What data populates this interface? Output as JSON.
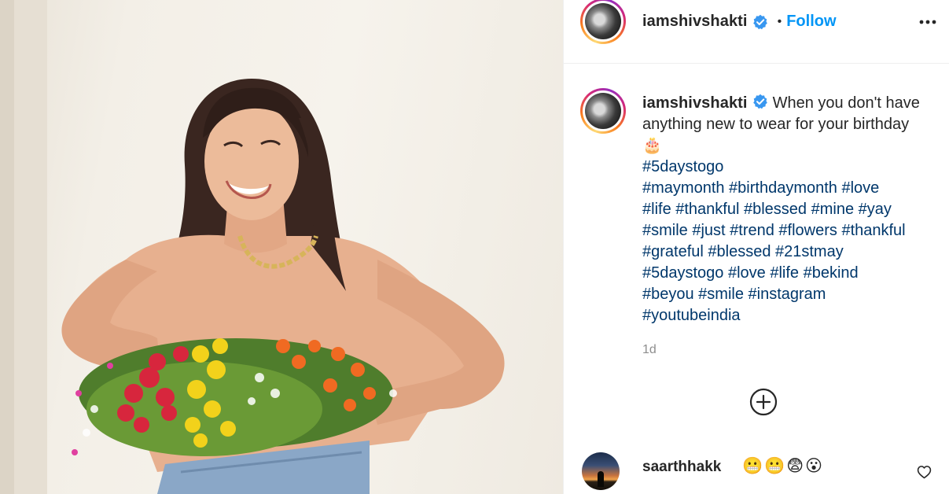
{
  "post": {
    "author": "iamshivshakti",
    "follow_label": "Follow",
    "separator": "•",
    "caption": {
      "text": "When you don't have anything new to wear for your birthday",
      "emoji": "🎂",
      "hashtag_lines": [
        "#5daystogo",
        "#maymonth #birthdaymonth #love",
        "#life #thankful #blessed #mine #yay",
        "#smile #just #trend #flowers #thankful",
        "#grateful #blessed #21stmay",
        "#5daystogo #love #life #bekind",
        "#beyou #smile #instagram",
        "#youtubeindia"
      ],
      "time": "1d"
    },
    "comment": {
      "user": "saarthhakk",
      "text": "😬😬😨😮"
    }
  },
  "icons": {
    "verified": "verified-badge-icon",
    "more": "more-options-icon",
    "add": "add-comment-icon",
    "like": "heart-icon"
  },
  "colors": {
    "link_blue": "#0095f6",
    "hashtag": "#00376b",
    "muted": "#8e8e8e",
    "text": "#262626"
  }
}
